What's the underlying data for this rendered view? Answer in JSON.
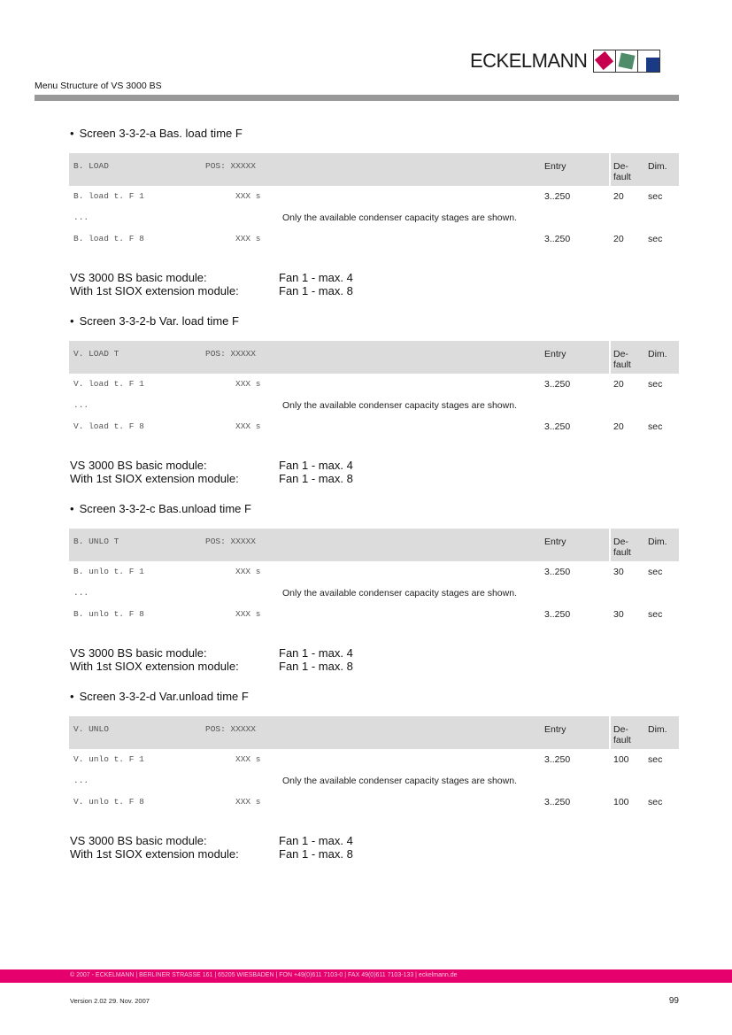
{
  "header": {
    "brand": "ECKELMANN",
    "logo_colors": [
      "#c6004f",
      "#4f8c6a",
      "#1b3a86"
    ],
    "subtitle": "Menu Structure of VS 3000 BS"
  },
  "table_headers": {
    "entry": "Entry",
    "default_line1": "De-",
    "default_line2": "fault",
    "dim": "Dim."
  },
  "sections": [
    {
      "title": "Screen 3-3-2-a Bas. load time F",
      "screen_label": "B. LOAD",
      "pos_label": "POS: XXXXX",
      "rows": [
        {
          "label": "B. load t. F 1",
          "value": "XXX s",
          "note": "",
          "entry": "3..250",
          "default": "20",
          "dim": "sec"
        },
        {
          "label": "...",
          "value": "",
          "note": "Only the available condenser capacity stages are shown.",
          "entry": "",
          "default": "",
          "dim": ""
        },
        {
          "label": "B. load t. F 8",
          "value": "XXX s",
          "note": "",
          "entry": "3..250",
          "default": "20",
          "dim": "sec"
        }
      ],
      "modules": [
        {
          "name": "VS 3000 BS basic module:",
          "value": "Fan 1 - max. 4"
        },
        {
          "name": "With 1st SIOX extension module:",
          "value": "Fan 1 - max. 8"
        }
      ]
    },
    {
      "title": "Screen 3-3-2-b Var. load time F",
      "screen_label": "V. LOAD T",
      "pos_label": "POS: XXXXX",
      "rows": [
        {
          "label": "V. load t. F 1",
          "value": "XXX s",
          "note": "",
          "entry": "3..250",
          "default": "20",
          "dim": "sec"
        },
        {
          "label": "...",
          "value": "",
          "note": "Only the available condenser capacity stages are shown.",
          "entry": "",
          "default": "",
          "dim": ""
        },
        {
          "label": "V. load t. F 8",
          "value": "XXX s",
          "note": "",
          "entry": "3..250",
          "default": "20",
          "dim": "sec"
        }
      ],
      "modules": [
        {
          "name": "VS 3000 BS basic module:",
          "value": "Fan 1 - max. 4"
        },
        {
          "name": "With 1st SIOX extension module:",
          "value": "Fan 1 - max. 8"
        }
      ]
    },
    {
      "title": "Screen 3-3-2-c Bas.unload time F",
      "screen_label": "B. UNLO T",
      "pos_label": "POS: XXXXX",
      "rows": [
        {
          "label": "B. unlo t. F 1",
          "value": "XXX s",
          "note": "",
          "entry": "3..250",
          "default": "30",
          "dim": "sec"
        },
        {
          "label": "...",
          "value": "",
          "note": "Only the available condenser capacity stages are shown.",
          "entry": "",
          "default": "",
          "dim": ""
        },
        {
          "label": "B. unlo t. F 8",
          "value": "XXX s",
          "note": "",
          "entry": "3..250",
          "default": "30",
          "dim": "sec"
        }
      ],
      "modules": [
        {
          "name": "VS 3000 BS basic module:",
          "value": "Fan 1 - max. 4"
        },
        {
          "name": "With 1st SIOX extension module:",
          "value": "Fan 1 - max. 8"
        }
      ]
    },
    {
      "title": "Screen 3-3-2-d Var.unload time F",
      "screen_label": "V. UNLO",
      "pos_label": "POS: XXXXX",
      "rows": [
        {
          "label": "V. unlo t. F 1",
          "value": "XXX s",
          "note": "",
          "entry": "3..250",
          "default": "100",
          "dim": "sec"
        },
        {
          "label": "...",
          "value": "",
          "note": "Only the available condenser capacity stages are shown.",
          "entry": "",
          "default": "",
          "dim": ""
        },
        {
          "label": "V. unlo t. F 8",
          "value": "XXX s",
          "note": "",
          "entry": "3..250",
          "default": "100",
          "dim": "sec"
        }
      ],
      "modules": [
        {
          "name": "VS 3000 BS basic module:",
          "value": "Fan 1 - max. 4"
        },
        {
          "name": "With 1st SIOX extension module:",
          "value": "Fan 1 - max. 8"
        }
      ]
    }
  ],
  "footer": {
    "contact": "© 2007 - ECKELMANN | BERLINER STRASSE 161 | 65205 WIESBADEN | FON +49(0)611 7103-0 | FAX 49(0)611 7103-133 | eckelmann.de",
    "version": "Version 2.02   29. Nov. 2007",
    "page_number": "99"
  }
}
